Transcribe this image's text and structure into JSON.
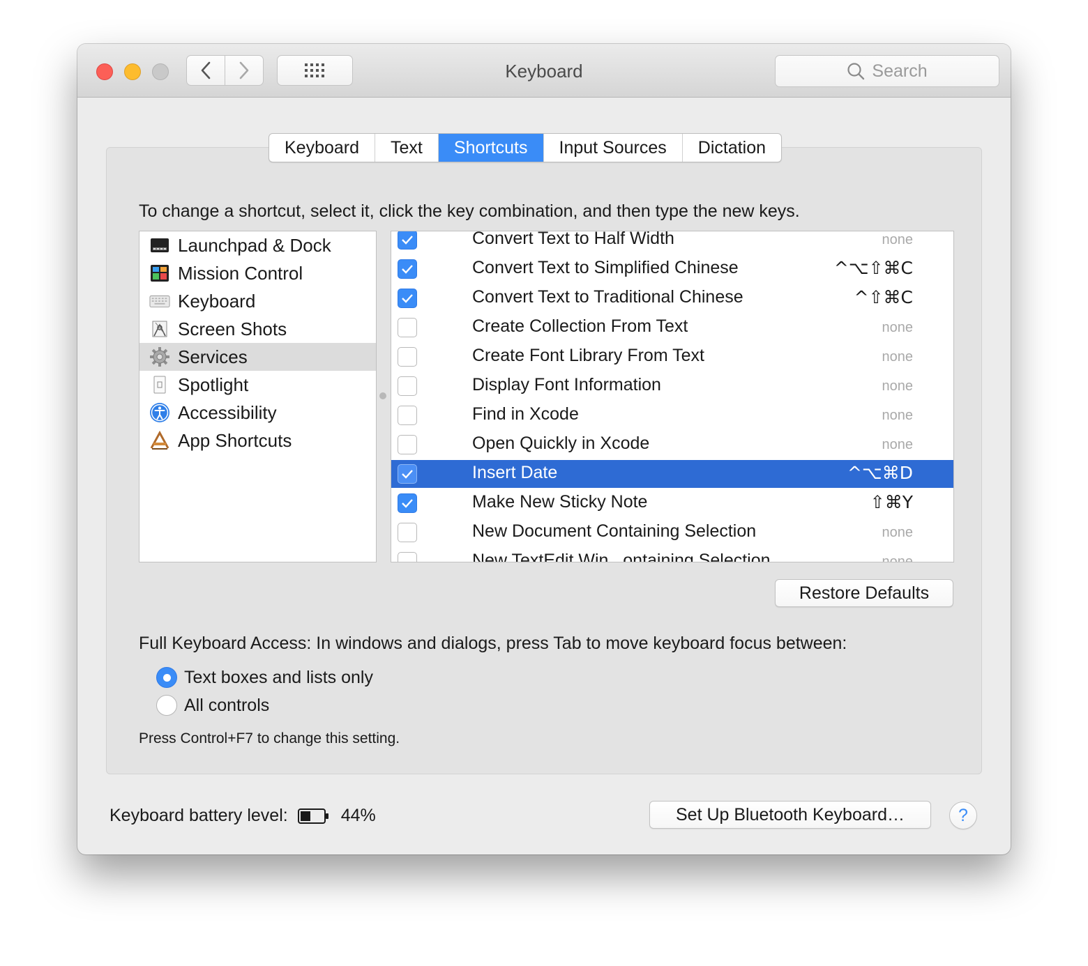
{
  "window": {
    "title": "Keyboard"
  },
  "search": {
    "placeholder": "Search"
  },
  "tabs": [
    {
      "label": "Keyboard",
      "selected": false
    },
    {
      "label": "Text",
      "selected": false
    },
    {
      "label": "Shortcuts",
      "selected": true
    },
    {
      "label": "Input Sources",
      "selected": false
    },
    {
      "label": "Dictation",
      "selected": false
    }
  ],
  "instruction": "To change a shortcut, select it, click the key combination, and then type the new keys.",
  "categories": [
    {
      "label": "Launchpad & Dock",
      "icon": "launchpad-dock-icon",
      "selected": false
    },
    {
      "label": "Mission Control",
      "icon": "mission-control-icon",
      "selected": false
    },
    {
      "label": "Keyboard",
      "icon": "keyboard-icon",
      "selected": false
    },
    {
      "label": "Screen Shots",
      "icon": "screenshot-icon",
      "selected": false
    },
    {
      "label": "Services",
      "icon": "gear-icon",
      "selected": true
    },
    {
      "label": "Spotlight",
      "icon": "spotlight-icon",
      "selected": false
    },
    {
      "label": "Accessibility",
      "icon": "accessibility-icon",
      "selected": false
    },
    {
      "label": "App Shortcuts",
      "icon": "app-shortcuts-icon",
      "selected": false
    }
  ],
  "services": [
    {
      "name": "Convert Text to Half Width",
      "checked": true,
      "shortcut": "none",
      "selected": false
    },
    {
      "name": "Convert Text to Simplified Chinese",
      "checked": true,
      "shortcut": "^⌥⇧⌘C",
      "selected": false
    },
    {
      "name": "Convert Text to Traditional Chinese",
      "checked": true,
      "shortcut": "^⇧⌘C",
      "selected": false
    },
    {
      "name": "Create Collection From Text",
      "checked": false,
      "shortcut": "none",
      "selected": false
    },
    {
      "name": "Create Font Library From Text",
      "checked": false,
      "shortcut": "none",
      "selected": false
    },
    {
      "name": "Display Font Information",
      "checked": false,
      "shortcut": "none",
      "selected": false
    },
    {
      "name": "Find in Xcode",
      "checked": false,
      "shortcut": "none",
      "selected": false
    },
    {
      "name": "Open Quickly in Xcode",
      "checked": false,
      "shortcut": "none",
      "selected": false
    },
    {
      "name": "Insert Date",
      "checked": true,
      "shortcut": "^⌥⌘D",
      "selected": true
    },
    {
      "name": "Make New Sticky Note",
      "checked": true,
      "shortcut": "⇧⌘Y",
      "selected": false
    },
    {
      "name": "New Document Containing Selection",
      "checked": false,
      "shortcut": "none",
      "selected": false
    },
    {
      "name": "New TextEdit Win...ontaining Selection",
      "checked": false,
      "shortcut": "none",
      "selected": false
    }
  ],
  "restore_defaults": "Restore Defaults",
  "full_keyboard_access": {
    "label": "Full Keyboard Access: In windows and dialogs, press Tab to move keyboard focus between:",
    "options": [
      {
        "label": "Text boxes and lists only",
        "selected": true
      },
      {
        "label": "All controls",
        "selected": false
      }
    ],
    "hint": "Press Control+F7 to change this setting."
  },
  "battery": {
    "label": "Keyboard battery level:",
    "value": "44%",
    "level": 0.44
  },
  "bluetooth_button": "Set Up Bluetooth Keyboard…",
  "help_label": "?",
  "colors": {
    "accent": "#3a8cf7",
    "selection": "#2e6bd4"
  }
}
